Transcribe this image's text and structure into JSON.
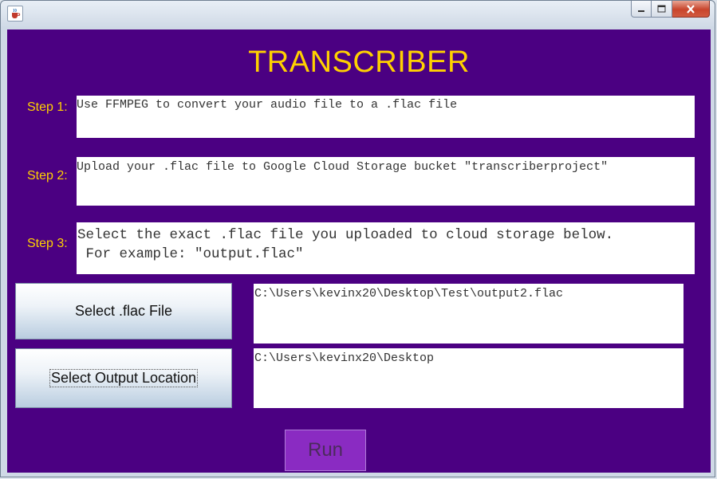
{
  "app": {
    "title": "TRANSCRIBER"
  },
  "steps": [
    {
      "label": "Step 1:",
      "text": "Use FFMPEG to convert your audio file to a .flac file"
    },
    {
      "label": "Step 2:",
      "text": "Upload your .flac file to Google Cloud Storage bucket \"transcriberproject\""
    },
    {
      "label": "Step 3:",
      "line1": "Select the exact .flac file you uploaded to cloud storage below.",
      "line2": " For example: \"output.flac\""
    }
  ],
  "buttons": {
    "select_flac": "Select .flac File",
    "select_output": "Select Output Location",
    "run": "Run"
  },
  "fields": {
    "flac_path": "C:\\Users\\kevinx20\\Desktop\\Test\\output2.flac",
    "output_path": "C:\\Users\\kevinx20\\Desktop"
  },
  "colors": {
    "background": "#4b0082",
    "accent_text": "#ffd100",
    "run_button": "#8a2bc2"
  }
}
